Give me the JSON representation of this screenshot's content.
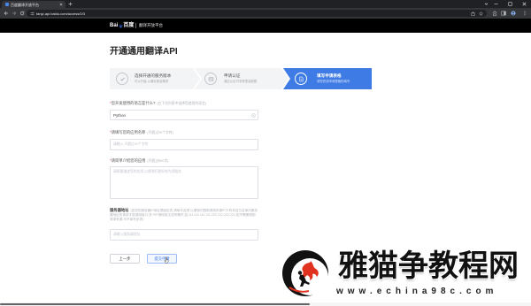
{
  "browser": {
    "tab_title": "百度翻译开放平台",
    "url": "fanyi-api.baidu.com/access/0/3",
    "colors": {
      "frame": "#202124",
      "toolbar": "#35363a",
      "omnibox": "#202124"
    }
  },
  "header": {
    "logo_latin": "Bai",
    "logo_cn": "百度",
    "product_name": "翻译开放平台"
  },
  "page": {
    "title": "开通通用翻译API"
  },
  "steps": [
    {
      "title": "选择开通的服务版本",
      "desc": "可以升级,以满足更高需求",
      "status": "completed",
      "icon": "check-icon"
    },
    {
      "title": "申请认证",
      "desc": "通过认证可享受更高配额",
      "status": "completed",
      "icon": "id-card-icon"
    },
    {
      "title": "填写申请表格",
      "desc": "请您完成申请表格的填写",
      "status": "active",
      "icon": "edit-form-icon"
    }
  ],
  "form": {
    "language": {
      "required_mark": "*",
      "label": "您开发使用的语言是什么?",
      "hint": "(在下拉列表中选择您使用的语言)",
      "value": "Python"
    },
    "app_name": {
      "required_mark": "*",
      "label": "请填写您的应用名称",
      "hint": "(不超过20个字符)",
      "placeholder": "请输入,不超过20个字符",
      "value": ""
    },
    "app_intro": {
      "required_mark": "*",
      "label": "请简单介绍您的应用",
      "hint": "(不超过500字)",
      "placeholder": "请简要描述您的应用,以便我们更好地为您服务",
      "value": ""
    },
    "server": {
      "label": "服务器地址",
      "hint": "(如您的服务器IP地址是固定的,请填写此项,以便我们限制调用来源IP,只有来自白名单内服务器地址的请求才能调用接口;多个IP请用英文逗号隔开,如:111.111.111.111,222.222.222.222;如不需要限制请求来源,可不填写此项)",
      "placeholder": "请输入服务器地址",
      "value": ""
    }
  },
  "buttons": {
    "prev": "上一步",
    "submit": "提交申请"
  },
  "watermark": {
    "title": "雅猫争教程网",
    "url": "www.echina98c.com"
  },
  "colors": {
    "accent": "#3f7be4",
    "required": "#e5484d",
    "header_bg": "#000000",
    "step_inactive": "#f3f4f6"
  }
}
